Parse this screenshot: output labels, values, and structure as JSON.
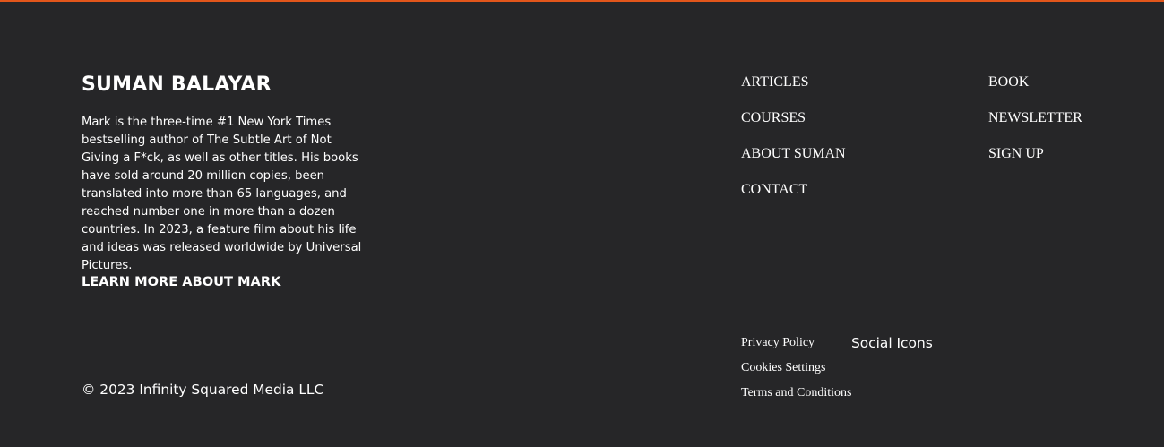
{
  "colors": {
    "background": "#262628",
    "accent": "#e2561b",
    "text": "#ffffff"
  },
  "brand": {
    "title": "SUMAN BALAYAR",
    "bio": "Mark is the three-time #1 New York Times bestselling author of The Subtle Art of Not Giving a F*ck, as well as other titles. His books have sold around 20 million copies, been translated into more than 65 languages, and reached number one in more than a dozen countries. In 2023, a feature film about his life and ideas was released worldwide by Universal Pictures.",
    "learn_more": "LEARN MORE ABOUT MARK"
  },
  "nav": {
    "column1": [
      "ARTICLES",
      "COURSES",
      "ABOUT SUMAN",
      "CONTACT"
    ],
    "column2": [
      "BOOK",
      "NEWSLETTER",
      "SIGN UP"
    ]
  },
  "legal": {
    "links": [
      "Privacy Policy",
      "Cookies Settings",
      "Terms and Conditions"
    ]
  },
  "social": {
    "placeholder": "Social Icons"
  },
  "copyright": "© 2023 Infinity Squared Media LLC"
}
